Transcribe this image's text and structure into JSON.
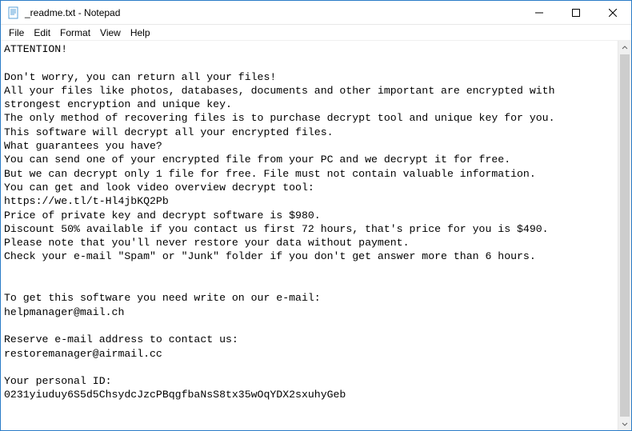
{
  "titlebar": {
    "icon": "notepad-icon",
    "title": "_readme.txt - Notepad"
  },
  "menubar": {
    "items": [
      "File",
      "Edit",
      "Format",
      "View",
      "Help"
    ]
  },
  "document": {
    "text": "ATTENTION!\n\nDon't worry, you can return all your files!\nAll your files like photos, databases, documents and other important are encrypted with strongest encryption and unique key.\nThe only method of recovering files is to purchase decrypt tool and unique key for you.\nThis software will decrypt all your encrypted files.\nWhat guarantees you have?\nYou can send one of your encrypted file from your PC and we decrypt it for free.\nBut we can decrypt only 1 file for free. File must not contain valuable information.\nYou can get and look video overview decrypt tool:\nhttps://we.tl/t-Hl4jbKQ2Pb\nPrice of private key and decrypt software is $980.\nDiscount 50% available if you contact us first 72 hours, that's price for you is $490.\nPlease note that you'll never restore your data without payment.\nCheck your e-mail \"Spam\" or \"Junk\" folder if you don't get answer more than 6 hours.\n\n\nTo get this software you need write on our e-mail:\nhelpmanager@mail.ch\n\nReserve e-mail address to contact us:\nrestoremanager@airmail.cc\n\nYour personal ID:\n0231yiuduy6S5d5ChsydcJzcPBqgfbaNsS8tx35wOqYDX2sxuhyGeb"
  }
}
